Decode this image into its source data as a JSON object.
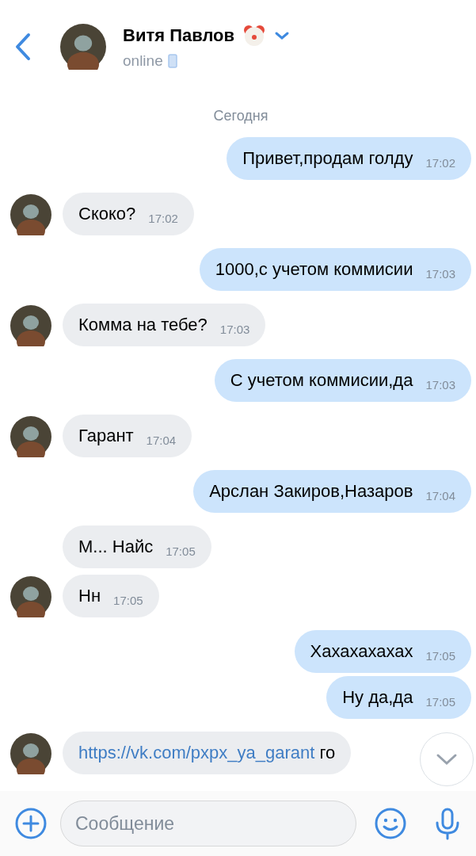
{
  "header": {
    "name": "Витя Павлов",
    "status": "online"
  },
  "date": "Сегодня",
  "messages": [
    {
      "kind": "out",
      "text": "Привет,продам голду",
      "time": "17:02"
    },
    {
      "kind": "in",
      "text": "Скоко?",
      "time": "17:02",
      "avatar": true
    },
    {
      "kind": "out",
      "text": "1000,с учетом коммисии",
      "time": "17:03"
    },
    {
      "kind": "in",
      "text": "Комма на тебе?",
      "time": "17:03",
      "avatar": true
    },
    {
      "kind": "out",
      "text": "С учетом коммисии,да",
      "time": "17:03"
    },
    {
      "kind": "in",
      "text": "Гарант",
      "time": "17:04",
      "avatar": true
    },
    {
      "kind": "out",
      "text": "Арслан Закиров,Назаров",
      "time": "17:04"
    },
    {
      "kind": "in",
      "text": "М... Найс",
      "time": "17:05",
      "avatar": false
    },
    {
      "kind": "in",
      "text": "Нн",
      "time": "17:05",
      "avatar": true
    },
    {
      "kind": "out",
      "text": "Хахахахахах",
      "time": "17:05"
    },
    {
      "kind": "out",
      "text": "Ну да,да",
      "time": "17:05"
    },
    {
      "kind": "in",
      "link": "https://vk.com/pxpx_ya_garant",
      "text": "го",
      "avatar": true
    }
  ],
  "composer": {
    "placeholder": "Сообщение"
  }
}
